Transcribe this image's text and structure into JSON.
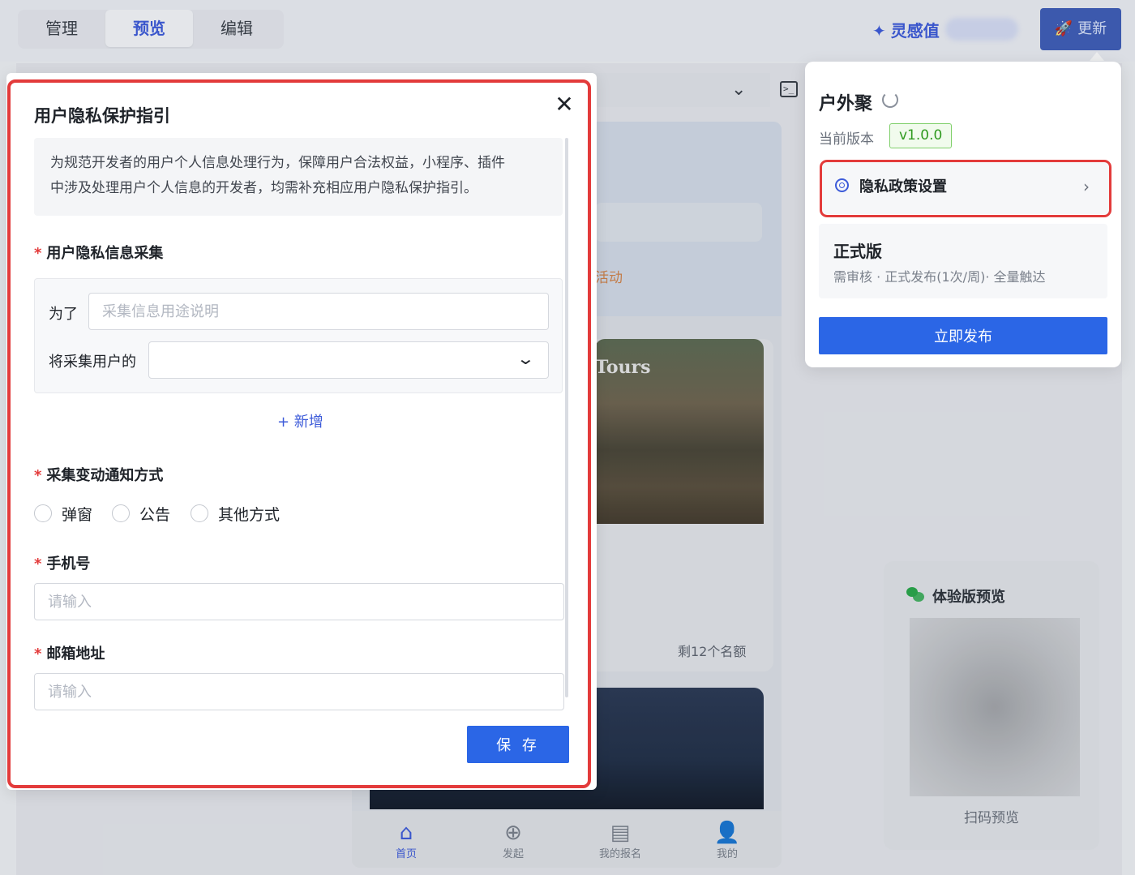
{
  "topbar": {
    "tabs": [
      {
        "label": "管理"
      },
      {
        "label": "预览"
      },
      {
        "label": "编辑"
      }
    ],
    "inspiration_label": "灵感值",
    "update_label": "更新"
  },
  "phone": {
    "activity_tag": "活动",
    "photo_text": "Tours",
    "remaining": "剩12个名额",
    "tabbar": [
      {
        "label": "首页",
        "icon": "home-icon"
      },
      {
        "label": "发起",
        "icon": "plus-circle-icon"
      },
      {
        "label": "我的报名",
        "icon": "clipboard-icon"
      },
      {
        "label": "我的",
        "icon": "user-icon"
      }
    ]
  },
  "preview_card": {
    "title": "体验版预览",
    "scan_label": "扫码预览"
  },
  "modal": {
    "title": "用户隐私保护指引",
    "close_glyph": "✕",
    "notice_line1": "为规范开发者的用户个人信息处理行为，保障用户合法权益，小程序、插件",
    "notice_line2": "中涉及处理用户个人信息的开发者，均需补充相应用户隐私保护指引。",
    "section_collect": "用户隐私信息采集",
    "purpose_label": "为了",
    "purpose_placeholder": "采集信息用途说明",
    "collect_label": "将采集用户的",
    "add_label": "+ 新增",
    "section_notify": "采集变动通知方式",
    "notify_options": [
      "弹窗",
      "公告",
      "其他方式"
    ],
    "section_phone": "手机号",
    "phone_placeholder": "请输入",
    "section_email": "邮箱地址",
    "email_placeholder": "请输入",
    "save_label": "保 存",
    "required_mark": "*"
  },
  "panel": {
    "title": "户外聚",
    "version_label": "当前版本",
    "version": "v1.0.0",
    "privacy_label": "隐私政策设置",
    "formal_title": "正式版",
    "formal_desc": "需审核 · 正式发布(1次/周)· 全量触达",
    "publish_label": "立即发布"
  },
  "colors": {
    "accent": "#2b66e6",
    "highlight": "#e33b3b",
    "version_green": "#2f9a1f"
  }
}
